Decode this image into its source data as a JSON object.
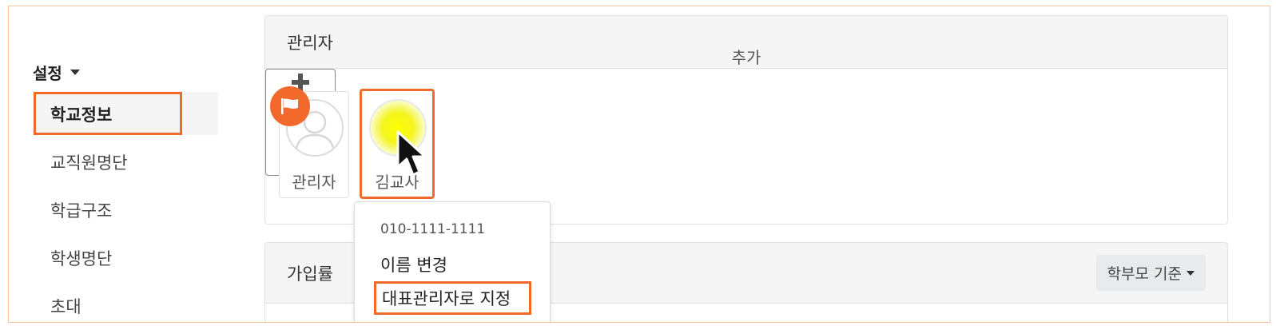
{
  "sidebar": {
    "header": "설정",
    "items": [
      {
        "label": "학교정보",
        "active": true
      },
      {
        "label": "교직원명단"
      },
      {
        "label": "학급구조"
      },
      {
        "label": "학생명단"
      },
      {
        "label": "초대"
      }
    ]
  },
  "admin_panel": {
    "title": "관리자",
    "cards": [
      {
        "name": "관리자",
        "avatar": "person-placeholder-icon",
        "badge": "flag-icon"
      },
      {
        "name": "김교사",
        "avatar": "highlighted-avatar"
      }
    ],
    "add_card": {
      "label": "추가",
      "icon": "plus-icon"
    }
  },
  "context_menu": {
    "phone": "010-1111-1111",
    "items": [
      "이름 변경",
      "대표관리자로 지정"
    ]
  },
  "signup_panel": {
    "title": "가입률",
    "filter": {
      "selected": "학부모 기준"
    }
  },
  "colors": {
    "accent": "#f06a2a",
    "badge": "#f26a2b",
    "highlight": "#ffff00"
  }
}
